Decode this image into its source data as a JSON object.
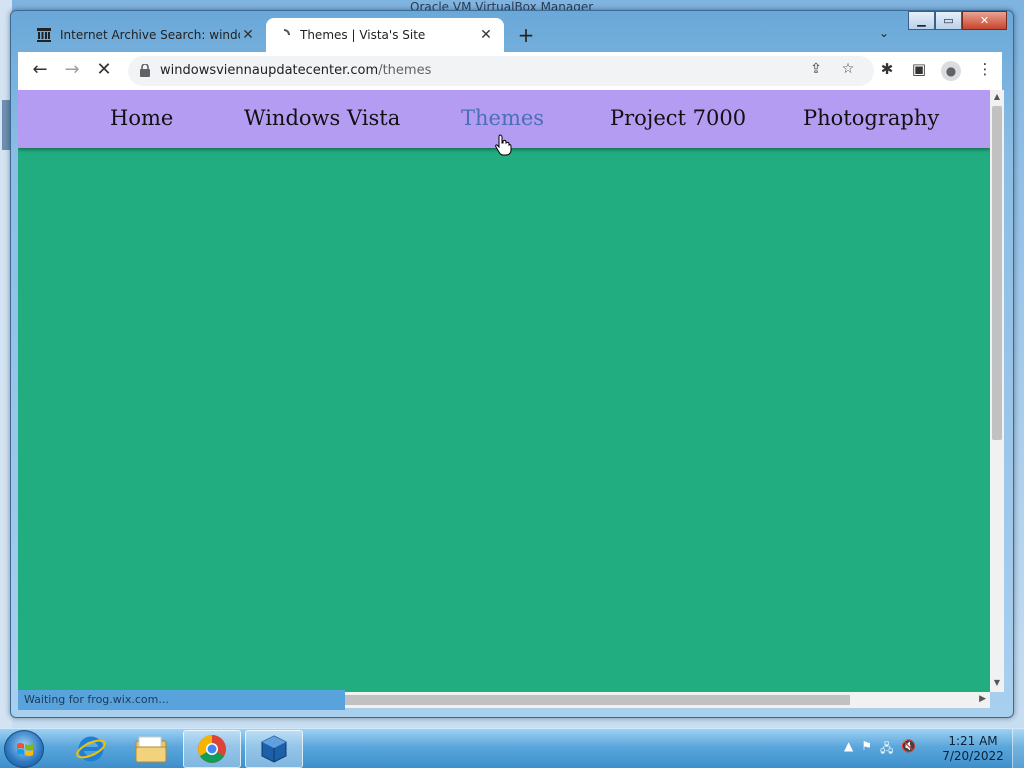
{
  "background_window": {
    "title": "Oracle VM VirtualBox Manager"
  },
  "tabs": [
    {
      "label": "Internet Archive Search: windows",
      "active": false
    },
    {
      "label": "Themes | Vista's Site",
      "active": true
    }
  ],
  "toolbar": {
    "url_host": "windowsviennaupdatecenter.com",
    "url_path": "/themes"
  },
  "site_nav": {
    "items": [
      "Home",
      "Windows Vista",
      "Themes",
      "Project 7000",
      "Photography"
    ],
    "current": "Themes"
  },
  "status_text": "Waiting for frog.wix.com...",
  "colors": {
    "page_bg": "#21ad80",
    "nav_bg": "#b49cf3",
    "nav_current": "#4a6fb5"
  },
  "taskbar": {
    "apps": [
      "internet-explorer",
      "windows-explorer",
      "google-chrome",
      "virtualbox"
    ],
    "active_app": "google-chrome",
    "time": "1:21 AM",
    "date": "7/20/2022"
  }
}
